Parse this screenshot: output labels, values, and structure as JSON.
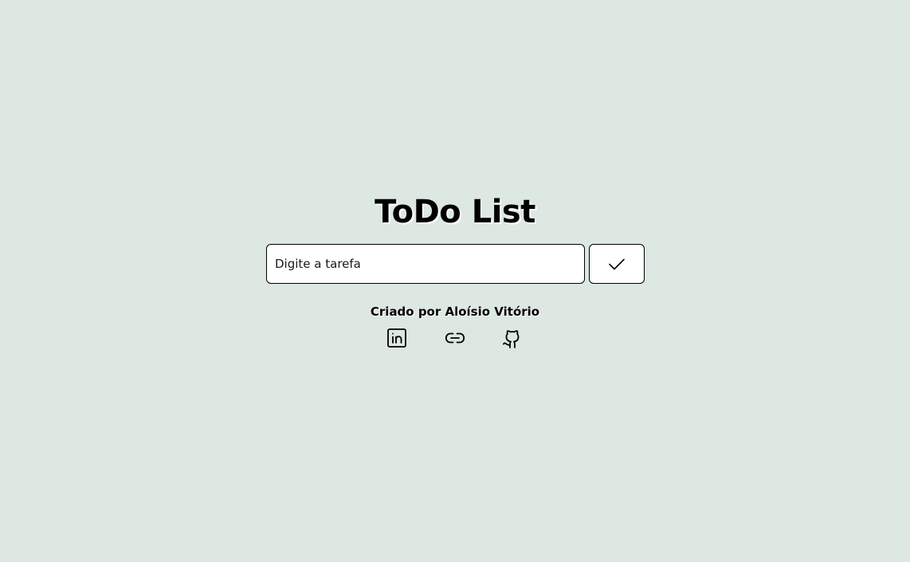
{
  "header": {
    "title": "ToDo List"
  },
  "form": {
    "input_placeholder": "Digite a tarefa",
    "input_value": "",
    "submit_icon": "check-icon"
  },
  "footer": {
    "credit": "Criado por Aloísio Vitório",
    "links": [
      {
        "icon": "linkedin-icon"
      },
      {
        "icon": "link-icon"
      },
      {
        "icon": "github-icon"
      }
    ]
  },
  "colors": {
    "background": "#dce8e1",
    "surface": "#ffffff",
    "text": "#000000"
  }
}
